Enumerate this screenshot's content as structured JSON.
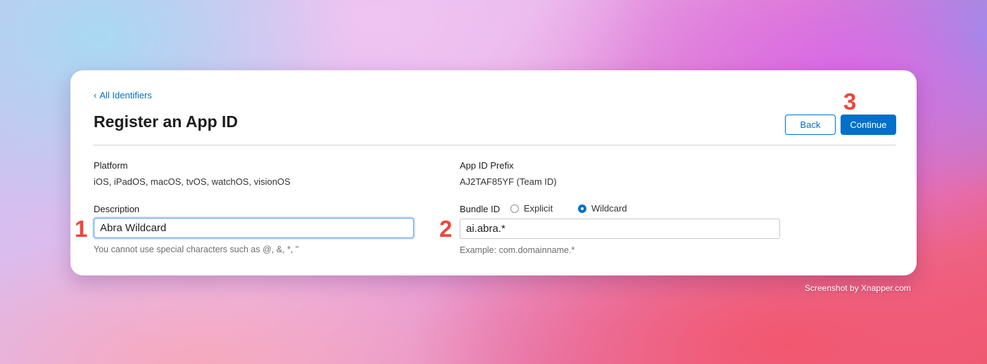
{
  "breadcrumb": {
    "chevron": "‹",
    "label": "All Identifiers"
  },
  "page": {
    "title": "Register an App ID"
  },
  "buttons": {
    "back": "Back",
    "continue": "Continue"
  },
  "platform": {
    "label": "Platform",
    "value": "iOS, iPadOS, macOS, tvOS, watchOS, visionOS"
  },
  "prefix": {
    "label": "App ID Prefix",
    "value": "AJ2TAF85YF (Team ID)"
  },
  "description": {
    "label": "Description",
    "value": "Abra Wildcard",
    "hint": "You cannot use special characters such as @, &, *, \""
  },
  "bundle": {
    "label": "Bundle ID",
    "options": [
      {
        "label": "Explicit",
        "selected": false
      },
      {
        "label": "Wildcard",
        "selected": true
      }
    ],
    "value": "ai.abra.*",
    "hint": "Example: com.domainname.*"
  },
  "annotations": [
    "1",
    "2",
    "3"
  ],
  "watermark": "Screenshot by Xnapper.com",
  "colors": {
    "accent": "#0070c9",
    "step_marker": "#f0453a"
  }
}
